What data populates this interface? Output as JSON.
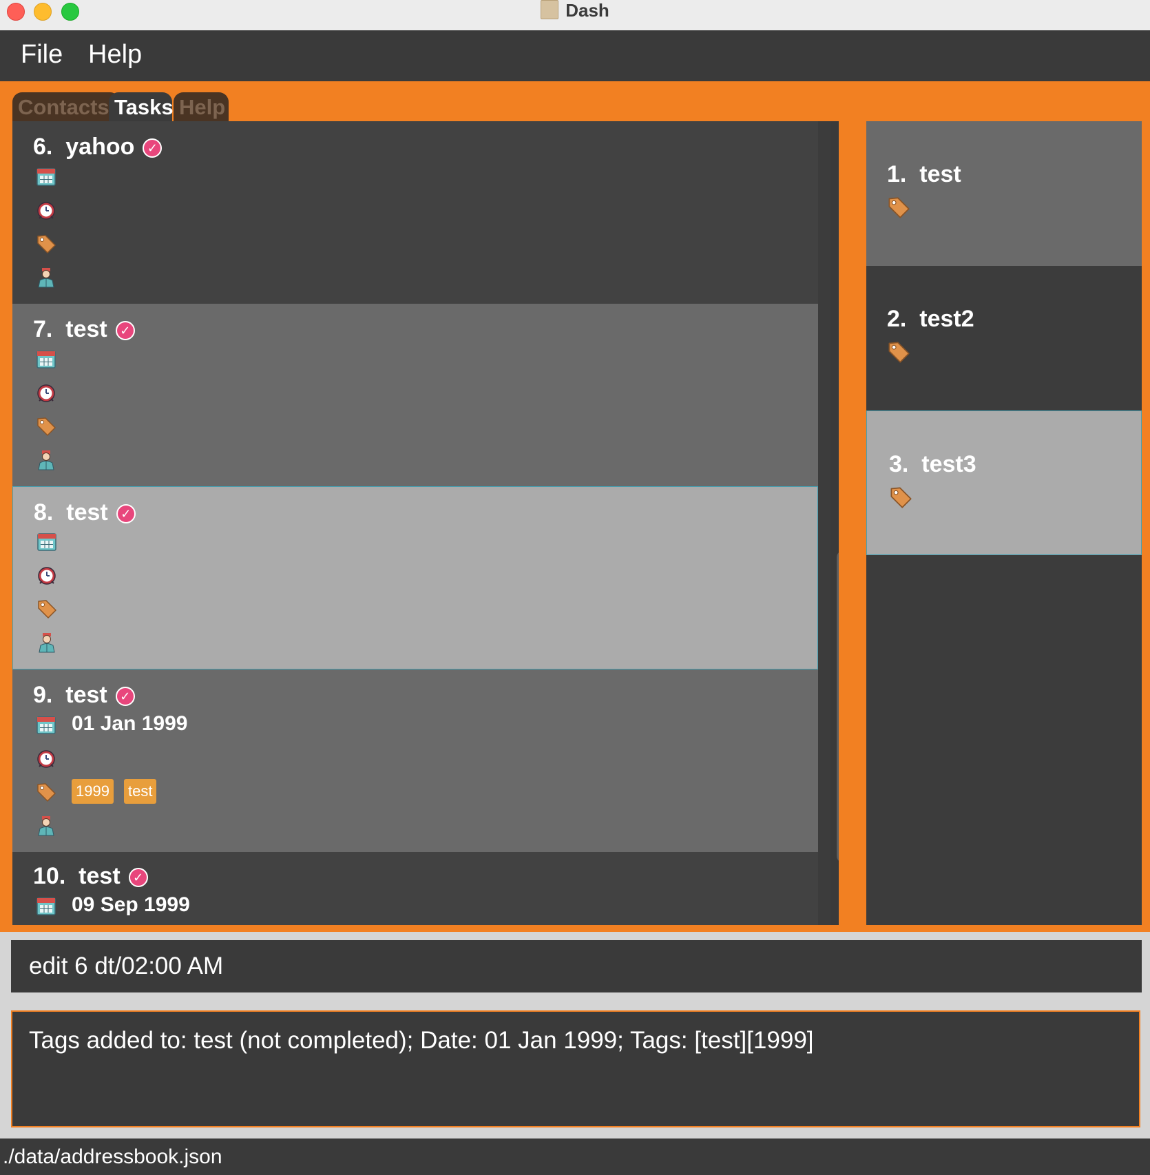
{
  "window": {
    "title": "Dash"
  },
  "menu": {
    "file": "File",
    "help": "Help"
  },
  "tabs": {
    "contacts": "Contacts",
    "tasks": "Tasks",
    "help": "Help"
  },
  "tasks": [
    {
      "index": "6.",
      "name": "yahoo",
      "date": "",
      "tags": []
    },
    {
      "index": "7.",
      "name": "test",
      "date": "",
      "tags": []
    },
    {
      "index": "8.",
      "name": "test",
      "date": "",
      "tags": []
    },
    {
      "index": "9.",
      "name": "test",
      "date": "01 Jan 1999",
      "tags": [
        "1999",
        "test"
      ]
    },
    {
      "index": "10.",
      "name": "test",
      "date": "09 Sep 1999",
      "tags": []
    }
  ],
  "tag_list": [
    {
      "index": "1.",
      "name": "test"
    },
    {
      "index": "2.",
      "name": "test2"
    },
    {
      "index": "3.",
      "name": "test3"
    }
  ],
  "command": {
    "value": "edit 6 dt/02:00 AM"
  },
  "result": {
    "text": "Tags added to: test (not completed); Date: 01 Jan 1999; Tags: [test][1999]"
  },
  "status": {
    "path": "./data/addressbook.json"
  },
  "colors": {
    "accent": "#f28022",
    "check": "#e8467c",
    "tag_chip": "#e89e3c"
  },
  "icons": [
    "calendar-icon",
    "alarm-clock-icon",
    "tag-icon",
    "person-icon",
    "check-circle-icon"
  ]
}
